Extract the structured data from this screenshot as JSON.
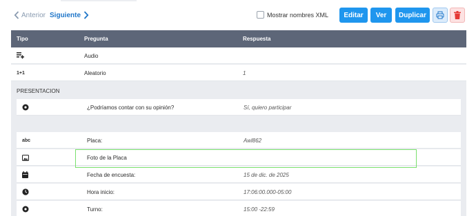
{
  "nav": {
    "prev_label": "Anterior",
    "next_label": "Siguiente"
  },
  "xml_toggle": {
    "label": "Mostrar nombres XML",
    "checked": false
  },
  "toolbar": {
    "edit_label": "Editar",
    "view_label": "Ver",
    "duplicate_label": "Duplicar",
    "print_icon": "printer-icon",
    "delete_icon": "trash-icon"
  },
  "colors": {
    "primary": "#1f96ee",
    "header_bg": "#5d6678",
    "highlight": "#79e06c",
    "delete": "#e53935"
  },
  "table": {
    "headers": {
      "tipo": "Tipo",
      "pregunta": "Pregunta",
      "respuesta": "Respuesta"
    },
    "top_rows": [
      {
        "icon": "playlist-add-icon",
        "type_text": "",
        "question": "Audio",
        "answer": ""
      },
      {
        "icon": "",
        "type_text": "1+1",
        "question": "Aleatorio",
        "answer": "1"
      }
    ],
    "section1": {
      "title": "PRESENTACION",
      "rows": [
        {
          "icon": "radio-icon",
          "type_text": "",
          "question": "¿Podríamos contar con su opinión?",
          "answer": "Sí, quiero participar"
        }
      ]
    },
    "section2": {
      "rows": [
        {
          "icon": "",
          "type_text": "abc",
          "question": "Placa:",
          "answer": "Awl862"
        },
        {
          "icon": "image-icon",
          "type_text": "",
          "question": "Foto de la Placa",
          "answer": ""
        },
        {
          "icon": "calendar-icon",
          "type_text": "",
          "question": "Fecha de encuesta:",
          "answer": "15 de dic. de 2025"
        },
        {
          "icon": "clock-icon",
          "type_text": "",
          "question": "Hora inicio:",
          "answer": "17:06:00.000-05:00"
        },
        {
          "icon": "radio-icon",
          "type_text": "",
          "question": "Turno:",
          "answer": "15:00 -22:59"
        }
      ]
    }
  }
}
